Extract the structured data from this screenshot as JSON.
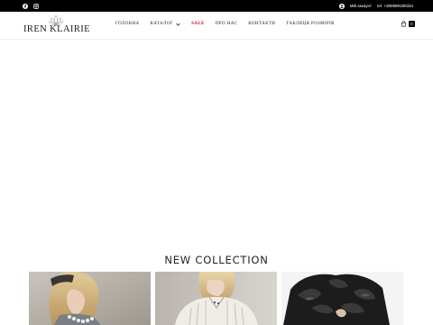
{
  "topbar": {
    "social": [
      "facebook-icon",
      "instagram-icon"
    ],
    "account_label": "Мій аккаунт",
    "phone": "tel. +380989190334"
  },
  "header": {
    "logo_text": "IREN KLAIRIE",
    "nav": [
      {
        "label": "ГОЛОВНА",
        "dropdown": false,
        "highlight": false
      },
      {
        "label": "КАТАЛОГ",
        "dropdown": true,
        "highlight": false
      },
      {
        "label": "SALE",
        "dropdown": false,
        "highlight": true
      },
      {
        "label": "ПРО НАС",
        "dropdown": false,
        "highlight": false
      },
      {
        "label": "КОНТАКТИ",
        "dropdown": false,
        "highlight": false
      },
      {
        "label": "ТАБЛИЦЯ РОЗМІРІВ",
        "dropdown": false,
        "highlight": false
      }
    ],
    "cart_count": "0"
  },
  "collection": {
    "title": "NEW COLLECTION"
  },
  "colors": {
    "topbar": "#000000",
    "sale": "#d0021b",
    "text": "#222222"
  }
}
